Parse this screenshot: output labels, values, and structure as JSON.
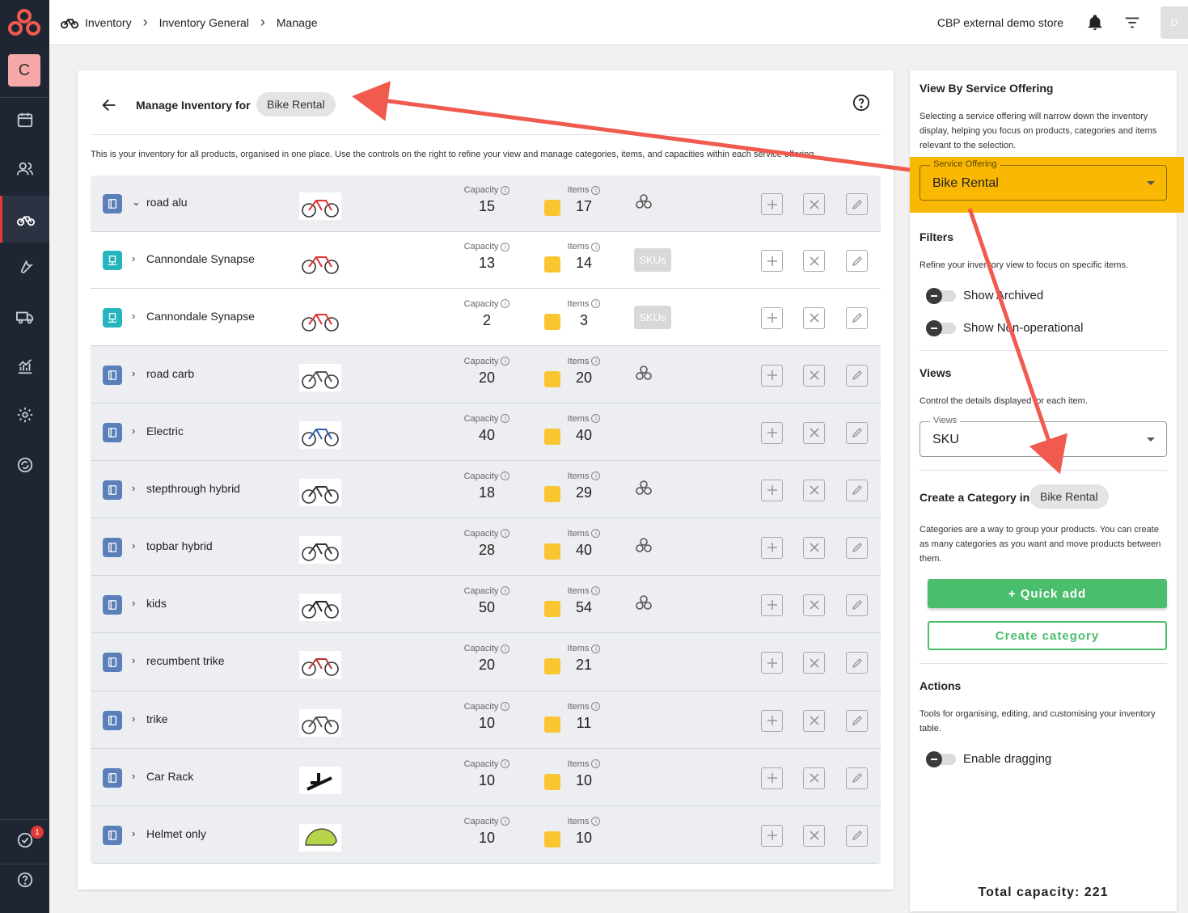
{
  "topbar": {
    "breadcrumbs": [
      "Inventory",
      "Inventory General",
      "Manage"
    ],
    "store_name": "CBP external demo store",
    "user_initial": "D"
  },
  "sidebar": {
    "account_initial": "C",
    "notification_count": "1",
    "items": [
      {
        "icon": "calendar-icon"
      },
      {
        "icon": "users-icon"
      },
      {
        "icon": "bike-icon",
        "active": true
      },
      {
        "icon": "wrench-icon"
      },
      {
        "icon": "truck-icon"
      },
      {
        "icon": "chart-icon"
      },
      {
        "icon": "gear-icon"
      },
      {
        "icon": "sync-icon"
      }
    ]
  },
  "main": {
    "title": "Manage Inventory for",
    "offering_chip": "Bike Rental",
    "description": "This is your inventory for all products, organised in one place. Use the controls on the right to refine your view and manage categories, items, and capacities within each service offering.",
    "capacity_label": "Capacity",
    "items_label": "Items",
    "rows": [
      {
        "name": "road alu",
        "capacity": "15",
        "items": "17",
        "type": "category",
        "expanded": true,
        "extra": "icon"
      },
      {
        "name": "Cannondale Synapse",
        "capacity": "13",
        "items": "14",
        "type": "product",
        "expanded": false,
        "extra": "SKUs"
      },
      {
        "name": "Cannondale Synapse",
        "capacity": "2",
        "items": "3",
        "type": "product",
        "expanded": false,
        "extra": "SKUs"
      },
      {
        "name": "road carb",
        "capacity": "20",
        "items": "20",
        "type": "category",
        "expanded": false,
        "extra": "icon"
      },
      {
        "name": "Electric",
        "capacity": "40",
        "items": "40",
        "type": "category",
        "expanded": false,
        "extra": ""
      },
      {
        "name": "stepthrough hybrid",
        "capacity": "18",
        "items": "29",
        "type": "category",
        "expanded": false,
        "extra": "icon"
      },
      {
        "name": "topbar hybrid",
        "capacity": "28",
        "items": "40",
        "type": "category",
        "expanded": false,
        "extra": "icon"
      },
      {
        "name": "kids",
        "capacity": "50",
        "items": "54",
        "type": "category",
        "expanded": false,
        "extra": "icon"
      },
      {
        "name": "recumbent trike",
        "capacity": "20",
        "items": "21",
        "type": "category",
        "expanded": false,
        "extra": ""
      },
      {
        "name": "trike",
        "capacity": "10",
        "items": "11",
        "type": "category",
        "expanded": false,
        "extra": ""
      },
      {
        "name": "Car Rack",
        "capacity": "10",
        "items": "10",
        "type": "category",
        "expanded": false,
        "extra": ""
      },
      {
        "name": "Helmet only",
        "capacity": "10",
        "items": "10",
        "type": "category",
        "expanded": false,
        "extra": ""
      }
    ]
  },
  "side": {
    "view_by_title": "View By Service Offering",
    "view_by_desc": "Selecting a service offering will narrow down the inventory display, helping you focus on products, categories and items relevant to the selection.",
    "service_offering_label": "Service Offering",
    "service_offering_value": "Bike Rental",
    "filters_title": "Filters",
    "filters_desc": "Refine your inventory view to focus on specific items.",
    "show_archived": "Show Archived",
    "show_non_operational": "Show Non-operational",
    "views_title": "Views",
    "views_desc": "Control the details displayed for each item.",
    "views_label": "Views",
    "views_value": "SKU",
    "create_category_title": "Create a Category in",
    "create_category_chip": "Bike Rental",
    "create_category_desc": "Categories are a way to group your products. You can create as many categories as you want and move products between them.",
    "quick_add": "+ Quick add",
    "create_category_button": "Create category",
    "actions_title": "Actions",
    "actions_desc": "Tools for organising, editing, and customising your inventory table.",
    "enable_dragging": "Enable dragging",
    "total_capacity": "Total capacity: 221"
  },
  "colors": {
    "sidebar_bg": "#1f2633",
    "highlight": "#f9b803",
    "accent_green": "#4bbe6e",
    "annotation_red": "#f05a4f"
  }
}
